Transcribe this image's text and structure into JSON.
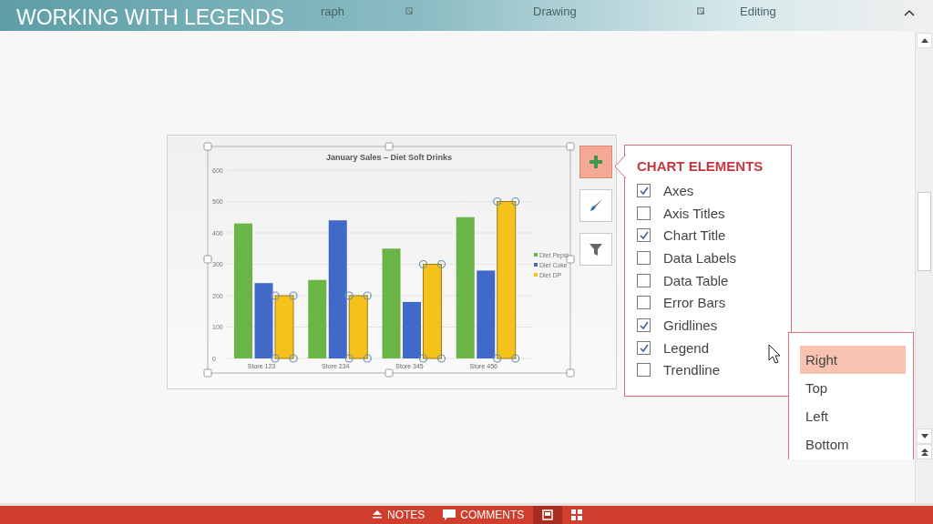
{
  "banner": {
    "title": "WORKING WITH LEGENDS"
  },
  "ribbon": {
    "groups": [
      "raph",
      "Drawing",
      "Editing"
    ]
  },
  "chart": {
    "chart_data": {
      "type": "bar",
      "title": "January Sales – Diet Soft Drinks",
      "categories": [
        "Store 123",
        "Store 234",
        "Store 345",
        "Store 456"
      ],
      "series": [
        {
          "name": "Diet Pepsi",
          "color": "#6ab545",
          "values": [
            430,
            250,
            350,
            450
          ]
        },
        {
          "name": "Diet Coke",
          "color": "#4169c8",
          "values": [
            240,
            440,
            180,
            280
          ]
        },
        {
          "name": "Diet DP",
          "color": "#f5c21c",
          "values": [
            200,
            200,
            300,
            500
          ]
        }
      ],
      "ylim": [
        0,
        600
      ],
      "yticks": [
        0,
        100,
        200,
        300,
        400,
        500,
        600
      ],
      "grid": true,
      "legend": true
    },
    "series_states": [
      {
        "selected": false
      },
      {
        "selected": false
      },
      {
        "selected": true
      }
    ]
  },
  "chart_buttons": [
    {
      "kind": "elements",
      "selected": true
    },
    {
      "kind": "styles",
      "selected": false
    },
    {
      "kind": "filter",
      "selected": false
    }
  ],
  "chart_elements": {
    "title": "CHART ELEMENTS",
    "items": [
      {
        "label": "Axes",
        "checked": true
      },
      {
        "label": "Axis Titles",
        "checked": false
      },
      {
        "label": "Chart Title",
        "checked": true
      },
      {
        "label": "Data Labels",
        "checked": false
      },
      {
        "label": "Data Table",
        "checked": false
      },
      {
        "label": "Error Bars",
        "checked": false
      },
      {
        "label": "Gridlines",
        "checked": true
      },
      {
        "label": "Legend",
        "checked": true
      },
      {
        "label": "Trendline",
        "checked": false
      }
    ]
  },
  "legend_menu": {
    "items": [
      {
        "label": "Right",
        "selected": true
      },
      {
        "label": "Top",
        "selected": false
      },
      {
        "label": "Left",
        "selected": false
      },
      {
        "label": "Bottom",
        "selected": false
      }
    ]
  },
  "status_bar": {
    "buttons": [
      {
        "kind": "notes",
        "label": "NOTES",
        "selected": false
      },
      {
        "kind": "comments",
        "label": "COMMENTS",
        "selected": false
      },
      {
        "kind": "normal-view",
        "selected": true
      },
      {
        "kind": "slide-sorter",
        "selected": false
      }
    ]
  }
}
